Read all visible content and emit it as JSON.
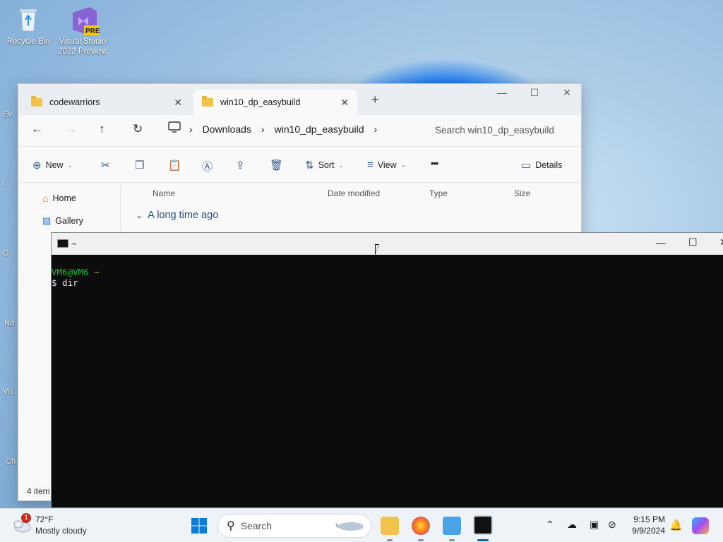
{
  "desktop": {
    "icons": [
      {
        "label": "Recycle Bin"
      },
      {
        "label": "Visual Studio 2022 Preview",
        "badge": "PRE"
      }
    ],
    "partial_labels": [
      "Ev",
      "I",
      "G",
      "No",
      "Vis",
      "Ch"
    ]
  },
  "explorer": {
    "tabs": [
      {
        "label": "codewarriors",
        "active": false
      },
      {
        "label": "win10_dp_easybuild",
        "active": true
      }
    ],
    "breadcrumb": [
      "Downloads",
      "win10_dp_easybuild"
    ],
    "search_placeholder": "Search win10_dp_easybuild",
    "toolbar": {
      "new_label": "New",
      "sort_label": "Sort",
      "view_label": "View",
      "more_label": "•••",
      "details_label": "Details"
    },
    "nav": {
      "home": "Home",
      "gallery": "Gallery"
    },
    "columns": [
      "Name",
      "Date modified",
      "Type",
      "Size"
    ],
    "group_header": "A long time ago",
    "status": "4 item"
  },
  "terminal": {
    "title": "~",
    "prompt_user": "VM6@VM6",
    "prompt_dir": "~",
    "command_line": "$ dir"
  },
  "taskbar": {
    "weather_temp": "72°F",
    "weather_desc": "Mostly cloudy",
    "weather_badge": "1",
    "search_label": "Search",
    "time": "9:15 PM",
    "date": "9/9/2024"
  },
  "colors": {
    "accent": "#0067c0",
    "terminal_bg": "#0c0c0c",
    "prompt_user": "#1fbf3a",
    "prompt_dir": "#d4b13a"
  }
}
